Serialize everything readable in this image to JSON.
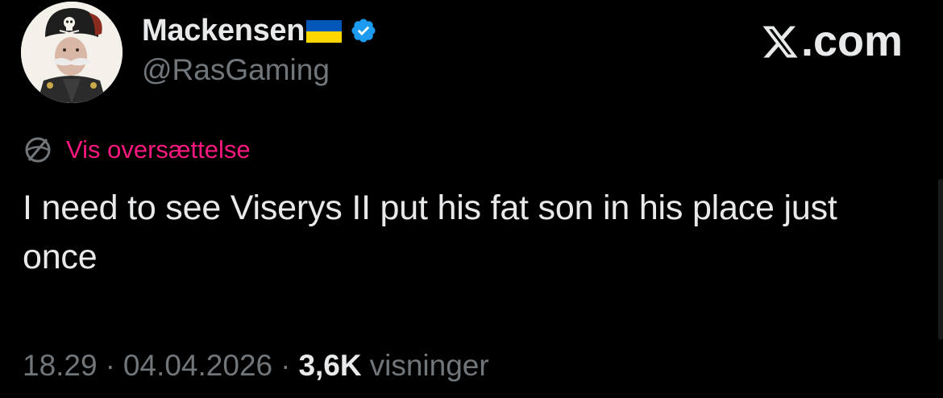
{
  "author": {
    "display_name": "Mackensen",
    "handle": "@RasGaming",
    "flag": "ukraine-flag",
    "verified_badge": "verified-icon"
  },
  "brand": {
    "label": ".com",
    "logo": "x-logo-icon"
  },
  "translate": {
    "label": "Vis oversættelse",
    "icon": "globe-icon"
  },
  "tweet": {
    "text": "I need to see Viserys II put his fat son in his place just once"
  },
  "meta": {
    "time": "18.29",
    "separator": "·",
    "date": "04.04.2026",
    "views_count": "3,6K",
    "views_label": "visninger"
  },
  "colors": {
    "background": "#000000",
    "primary_text": "#e7e9ea",
    "secondary_text": "#71767b",
    "translate_link": "#f91880",
    "verified": "#1d9bf0",
    "flag_blue": "#0057b7",
    "flag_yellow": "#ffd700"
  }
}
